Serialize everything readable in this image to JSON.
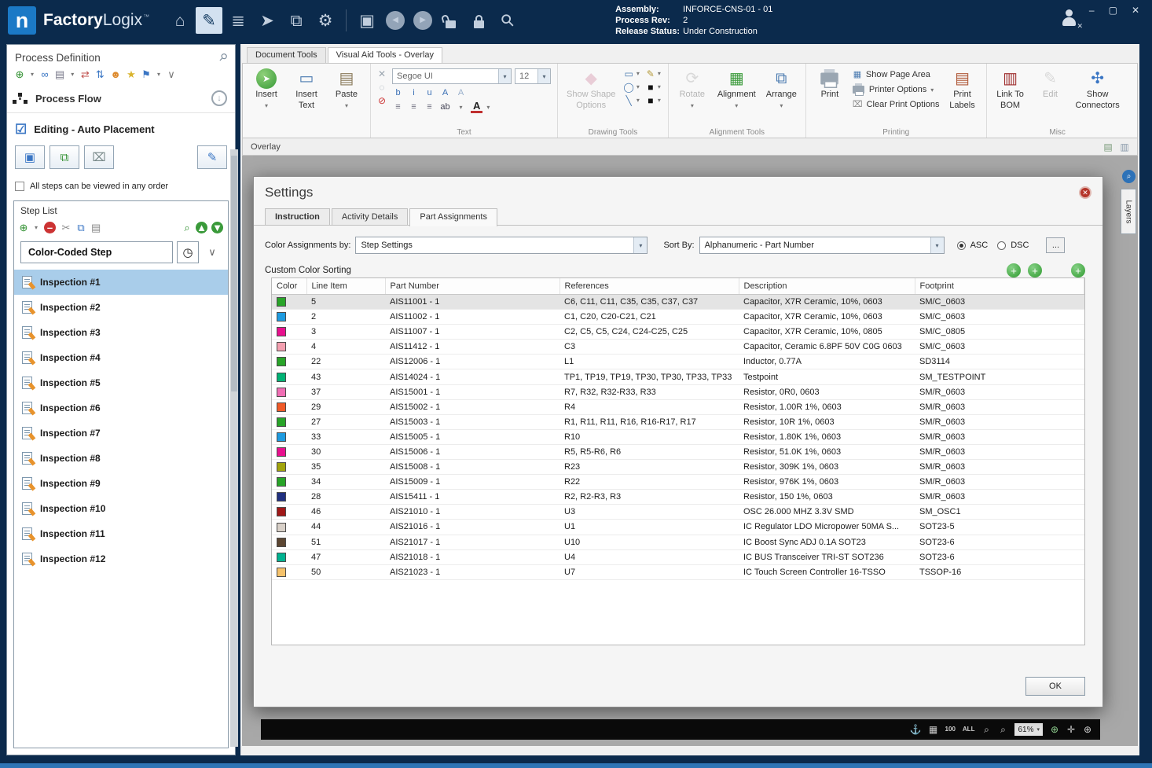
{
  "glyphs": {
    "dd": "▾",
    "chevron": "∨",
    "clock": "◷",
    "pin": "⚲",
    "insert_arrow": "➤",
    "insert_text_ic": "▭",
    "paste_ic": "▤",
    "shape_ic": "◆",
    "rotate_ic": "⟳",
    "align_ic": "▦",
    "arrange_ic": "⧉",
    "page_area_ic": "▦",
    "clear_ic": "⌧",
    "labels_ic": "▤",
    "book_ic": "▥",
    "edit_ic": "✎",
    "conn_ic": "✣",
    "font_color_A": "A",
    "down_arrow": "↓",
    "save_ic": "▣",
    "import_ic": "⧉",
    "discard_ic": "⌧",
    "edit_pencil_ic": "✎",
    "close_x": "✕",
    "plus": "+",
    "layers_ic": "⌕"
  },
  "titlebar": {
    "logo_letter": "n",
    "app_name_bold": "Factory",
    "app_name_light": "Logix",
    "trademark": "™",
    "icons": [
      {
        "name": "home-icon",
        "glyph": "⌂"
      },
      {
        "name": "edit-document-icon",
        "glyph": "✎",
        "cls": "active"
      },
      {
        "name": "stack-icon",
        "glyph": "≣"
      },
      {
        "name": "navigate-icon",
        "glyph": "➤"
      },
      {
        "name": "pages-icon",
        "glyph": "⧉"
      },
      {
        "name": "settings-gear-icon",
        "glyph": "⚙"
      },
      {
        "sep": true
      },
      {
        "name": "save-icon",
        "glyph": "▣"
      },
      {
        "name": "back-icon",
        "glyph": "◀",
        "cls": "circ-btn"
      },
      {
        "name": "forward-icon",
        "glyph": "▶",
        "cls": "circ-btn"
      },
      {
        "name": "unlock-icon",
        "glyph": "",
        "cls": "lock-icon unlocked"
      },
      {
        "name": "lock-icon",
        "glyph": "",
        "cls": "lock-icon"
      },
      {
        "name": "search-lock-icon",
        "glyph": "⚲",
        "cls": "rot45"
      }
    ],
    "assembly_label": "Assembly:",
    "assembly_value": "INFORCE-CNS-01 - 01",
    "process_rev_label": "Process Rev:",
    "process_rev_value": "2",
    "release_status_label": "Release Status:",
    "release_status_value": "Under Construction",
    "minimize": "–",
    "maximize": "▢",
    "close": "✕"
  },
  "left_panel": {
    "title": "Process Definition",
    "toolbar_icons": [
      {
        "name": "add-step-icon",
        "glyph": "⊕",
        "color": "#2e8f2e"
      },
      {
        "name": "add-step-dropdown-icon",
        "glyph": "▾",
        "cls": "tiny"
      },
      {
        "name": "link-icon",
        "glyph": "∞",
        "color": "#3a76c4"
      },
      {
        "name": "print-icon",
        "glyph": "▤",
        "color": "#778"
      },
      {
        "name": "print-dropdown-icon",
        "glyph": "▾",
        "cls": "tiny"
      },
      {
        "name": "transfer-icon",
        "glyph": "⇄",
        "color": "#c0504d"
      },
      {
        "name": "reorder-icon",
        "glyph": "⇅",
        "color": "#3a76c4"
      },
      {
        "name": "user-icon",
        "glyph": "☻",
        "color": "#dd8a2e"
      },
      {
        "name": "star-icon",
        "glyph": "★",
        "color": "#d9b42e"
      },
      {
        "name": "flag-icon",
        "glyph": "⚑",
        "color": "#3a76c4"
      },
      {
        "name": "flag-dropdown-icon",
        "glyph": "▾",
        "cls": "tiny"
      },
      {
        "name": "more-dropdown-icon",
        "glyph": "∨",
        "color": "#777"
      }
    ],
    "process_flow_label": "Process Flow",
    "editing_label": "Editing - Auto Placement",
    "checkbox_label": "All steps can be viewed in any order",
    "step_list_title": "Step List",
    "sl_toolbar_left": [
      {
        "name": "add-icon",
        "glyph": "⊕",
        "color": "#2e8f2e"
      },
      {
        "name": "add-dropdown-icon",
        "glyph": "▾",
        "cls": "tiny"
      },
      {
        "name": "remove-icon",
        "glyph": "–",
        "cls": "red-circ"
      },
      {
        "name": "cut-icon",
        "glyph": "✂",
        "color": "#888"
      },
      {
        "name": "copy-icon",
        "glyph": "⧉",
        "color": "#3a76c4"
      },
      {
        "name": "paste-icon",
        "glyph": "▤",
        "color": "#888"
      }
    ],
    "sl_toolbar_right": [
      {
        "name": "zoom-search-icon",
        "glyph": "⌕",
        "color": "#2e8f2e"
      },
      {
        "name": "move-up-icon",
        "glyph": "▲",
        "cls": "grn-circ"
      },
      {
        "name": "move-down-icon",
        "glyph": "▼",
        "cls": "grn-circ"
      }
    ],
    "color_coded_label": "Color-Coded Step",
    "steps": [
      "Inspection #1",
      "Inspection #2",
      "Inspection #3",
      "Inspection #4",
      "Inspection #5",
      "Inspection #6",
      "Inspection #7",
      "Inspection #8",
      "Inspection #9",
      "Inspection #10",
      "Inspection #11",
      "Inspection #12"
    ],
    "selected_index": 0
  },
  "ribbon": {
    "tab_document_tools": "Document Tools",
    "tab_visual_aid": "Visual Aid Tools - Overlay",
    "insert_label": "Insert",
    "insert_text_l1": "Insert",
    "insert_text_l2": "Text",
    "paste_label": "Paste",
    "text_mini_icons": [
      {
        "name": "clear-format-icon",
        "glyph": "✕",
        "color": "#9aa5af"
      },
      {
        "name": "select-none-icon",
        "glyph": "◌",
        "color": "#9aa5af"
      },
      {
        "name": "block-icon",
        "glyph": "⊘",
        "color": "#cc3333"
      }
    ],
    "font_name": "Segoe UI",
    "font_size": "12",
    "format_row1": [
      {
        "name": "bold-icon",
        "glyph": "b",
        "color": "#3a6fb5"
      },
      {
        "name": "italic-icon",
        "glyph": "i",
        "color": "#3a6fb5"
      },
      {
        "name": "underline-icon",
        "glyph": "u",
        "color": "#3a6fb5"
      },
      {
        "name": "grow-font-icon",
        "glyph": "A",
        "color": "#3a6fb5"
      },
      {
        "name": "shrink-font-icon",
        "glyph": "A",
        "color": "#9ab0cc"
      }
    ],
    "format_row2": [
      {
        "name": "align-left-icon",
        "glyph": "≡",
        "color": "#667"
      },
      {
        "name": "align-center-icon",
        "glyph": "≡",
        "color": "#667"
      },
      {
        "name": "align-right-icon",
        "glyph": "≡",
        "color": "#667"
      },
      {
        "name": "highlight-icon",
        "glyph": "ab",
        "color": "#445"
      },
      {
        "name": "highlight-dropdown-icon",
        "glyph": "▾",
        "cls": "tiny"
      }
    ],
    "text_group_label": "Text",
    "show_shape_l1": "Show Shape",
    "show_shape_l2": "Options",
    "shape_col": [
      {
        "name": "shape-rect-icon",
        "glyph": "▭",
        "color": "#4a7ab0"
      },
      {
        "name": "shape-rect-dropdown-icon",
        "glyph": "▾",
        "cls": "tiny"
      },
      {
        "name": "shape-ellipse-icon",
        "glyph": "◯",
        "color": "#4a7ab0"
      },
      {
        "name": "shape-ellipse-dropdown-icon",
        "glyph": "▾",
        "cls": "tiny"
      },
      {
        "name": "shape-line-icon",
        "glyph": "╲",
        "color": "#4a7ab0"
      },
      {
        "name": "shape-line-dropdown-icon",
        "glyph": "▾",
        "cls": "tiny"
      }
    ],
    "color_col": [
      {
        "name": "pen-color-icon",
        "glyph": "✎",
        "color": "#b59a3a"
      },
      {
        "name": "pen-color-dropdown-icon",
        "glyph": "▾",
        "cls": "tiny"
      },
      {
        "name": "stroke-color-icon",
        "glyph": "■",
        "color": "#111111"
      },
      {
        "name": "stroke-color-dropdown-icon",
        "glyph": "▾",
        "cls": "tiny"
      },
      {
        "name": "fill-color-icon",
        "glyph": "■",
        "color": "#111111"
      },
      {
        "name": "fill-color-dropdown-icon",
        "glyph": "▾",
        "cls": "tiny"
      }
    ],
    "drawing_group_label": "Drawing Tools",
    "rotate_label": "Rotate",
    "alignment_label": "Alignment",
    "arrange_label": "Arrange",
    "alignment_group_label": "Alignment Tools",
    "print_label": "Print",
    "show_page_area": "Show Page Area",
    "printer_options": "Printer Options",
    "clear_print_options": "Clear Print Options",
    "print_labels_l1": "Print",
    "print_labels_l2": "Labels",
    "printing_group_label": "Printing",
    "link_bom_l1": "Link To",
    "link_bom_l2": "BOM",
    "edit_label": "Edit",
    "show_conn_l1": "Show",
    "show_conn_l2": "Connectors",
    "misc_group_label": "Misc"
  },
  "overlay_bar": {
    "title": "Overlay",
    "icons": [
      {
        "name": "overlay-doc-icon",
        "glyph": "▤",
        "color": "#7a9a7a"
      },
      {
        "name": "overlay-layers-icon",
        "glyph": "▥",
        "color": "#8a9aaa"
      }
    ]
  },
  "canvas": {
    "layers_tab_label": "Layers",
    "zoom_value": "61%",
    "bottom_icons": [
      {
        "name": "anchor-icon",
        "glyph": "⚓",
        "color": "#cfcfcf"
      },
      {
        "name": "grid-icon",
        "glyph": "▦",
        "color": "#cfcfcf"
      },
      {
        "name": "zoom-100-icon",
        "glyph": "100",
        "cls": "txt"
      },
      {
        "name": "zoom-all-icon",
        "glyph": "ALL",
        "cls": "txt"
      },
      {
        "name": "zoom-out-icon",
        "glyph": "⌕",
        "color": "#cfcfcf"
      },
      {
        "name": "zoom-in-icon",
        "glyph": "⌕",
        "color": "#cfcfcf"
      }
    ],
    "bottom_icons_after": [
      {
        "name": "zoom-step-icon",
        "glyph": "⊕",
        "color": "#8fcf8f"
      },
      {
        "name": "pan-icon",
        "glyph": "✛",
        "color": "#cfcfcf"
      },
      {
        "name": "target-icon",
        "glyph": "⊕",
        "color": "#cfcfcf"
      }
    ]
  },
  "dialog": {
    "title": "Settings",
    "tab_instruction": "Instruction",
    "tab_activity_details": "Activity Details",
    "tab_part_assignments": "Part Assignments",
    "color_assignments_label": "Color Assignments by:",
    "color_assignments_value": "Step Settings",
    "sort_by_label": "Sort By:",
    "sort_by_value": "Alphanumeric - Part Number",
    "asc_label": "ASC",
    "dsc_label": "DSC",
    "sort_direction": "ASC",
    "more_button": "...",
    "custom_color_sorting_label": "Custom Color Sorting",
    "ok_button": "OK",
    "table": {
      "columns": [
        "Color",
        "Line Item",
        "Part Number",
        "References",
        "Description",
        "Footprint"
      ],
      "selected_row_index": 0,
      "rows": [
        {
          "color": "#28a428",
          "line_item": "5",
          "part_number": "AIS11001 - 1",
          "references": "C6, C11, C11, C35, C35, C37, C37",
          "description": "Capacitor,  X7R Ceramic, 10%, 0603",
          "footprint": "SM/C_0603"
        },
        {
          "color": "#1e9be0",
          "line_item": "2",
          "part_number": "AIS11002 - 1",
          "references": "C1, C20, C20-C21, C21",
          "description": "Capacitor,  X7R Ceramic, 10%, 0603",
          "footprint": "SM/C_0603"
        },
        {
          "color": "#e8108e",
          "line_item": "3",
          "part_number": "AIS11007 - 1",
          "references": "C2, C5, C5, C24, C24-C25, C25",
          "description": "Capacitor,  X7R Ceramic, 10%, 0805",
          "footprint": "SM/C_0805"
        },
        {
          "color": "#f4a0b0",
          "line_item": "4",
          "part_number": "AIS11412 - 1",
          "references": "C3",
          "description": "Capacitor, Ceramic 6.8PF 50V C0G 0603",
          "footprint": "SM/C_0603"
        },
        {
          "color": "#28a428",
          "line_item": "22",
          "part_number": "AIS12006 - 1",
          "references": "L1",
          "description": "Inductor, 0.77A",
          "footprint": "SD3114"
        },
        {
          "color": "#00b274",
          "line_item": "43",
          "part_number": "AIS14024 - 1",
          "references": "TP1, TP19, TP19, TP30, TP30, TP33, TP33",
          "description": "Testpoint",
          "footprint": "SM_TESTPOINT"
        },
        {
          "color": "#f06eb4",
          "line_item": "37",
          "part_number": "AIS15001 - 1",
          "references": "R7, R32, R32-R33, R33",
          "description": "Resistor, 0R0, 0603",
          "footprint": "SM/R_0603"
        },
        {
          "color": "#f05a28",
          "line_item": "29",
          "part_number": "AIS15002 - 1",
          "references": "R4",
          "description": "Resistor, 1.00R 1%, 0603",
          "footprint": "SM/R_0603"
        },
        {
          "color": "#28a428",
          "line_item": "27",
          "part_number": "AIS15003 - 1",
          "references": "R1, R11, R11, R16, R16-R17, R17",
          "description": "Resistor, 10R 1%, 0603",
          "footprint": "SM/R_0603"
        },
        {
          "color": "#1e9be0",
          "line_item": "33",
          "part_number": "AIS15005 - 1",
          "references": "R10",
          "description": "Resistor, 1.80K 1%, 0603",
          "footprint": "SM/R_0603"
        },
        {
          "color": "#e8108e",
          "line_item": "30",
          "part_number": "AIS15006 - 1",
          "references": "R5, R5-R6, R6",
          "description": "Resistor, 51.0K 1%, 0603",
          "footprint": "SM/R_0603"
        },
        {
          "color": "#a2a40c",
          "line_item": "35",
          "part_number": "AIS15008 - 1",
          "references": "R23",
          "description": "Resistor, 309K 1%, 0603",
          "footprint": "SM/R_0603"
        },
        {
          "color": "#28a428",
          "line_item": "34",
          "part_number": "AIS15009 - 1",
          "references": "R22",
          "description": "Resistor, 976K 1%, 0603",
          "footprint": "SM/R_0603"
        },
        {
          "color": "#203080",
          "line_item": "28",
          "part_number": "AIS15411 - 1",
          "references": "R2, R2-R3, R3",
          "description": "Resistor, 150 1%, 0603",
          "footprint": "SM/R_0603"
        },
        {
          "color": "#a01818",
          "line_item": "46",
          "part_number": "AIS21010 - 1",
          "references": "U3",
          "description": "OSC 26.000 MHZ 3.3V SMD",
          "footprint": "SM_OSC1"
        },
        {
          "color": "#d8d0c8",
          "line_item": "44",
          "part_number": "AIS21016 - 1",
          "references": "U1",
          "description": "IC Regulator LDO Micropower 50MA S...",
          "footprint": "SOT23-5"
        },
        {
          "color": "#5c4632",
          "line_item": "51",
          "part_number": "AIS21017 - 1",
          "references": "U10",
          "description": "IC Boost Sync ADJ 0.1A SOT23",
          "footprint": "SOT23-6"
        },
        {
          "color": "#00b290",
          "line_item": "47",
          "part_number": "AIS21018 - 1",
          "references": "U4",
          "description": "IC BUS Transceiver TRI-ST SOT236",
          "footprint": "SOT23-6"
        },
        {
          "color": "#f5c26b",
          "line_item": "50",
          "part_number": "AIS21023 - 1",
          "references": "U7",
          "description": "IC Touch Screen Controller 16-TSSO",
          "footprint": "TSSOP-16"
        }
      ]
    }
  }
}
